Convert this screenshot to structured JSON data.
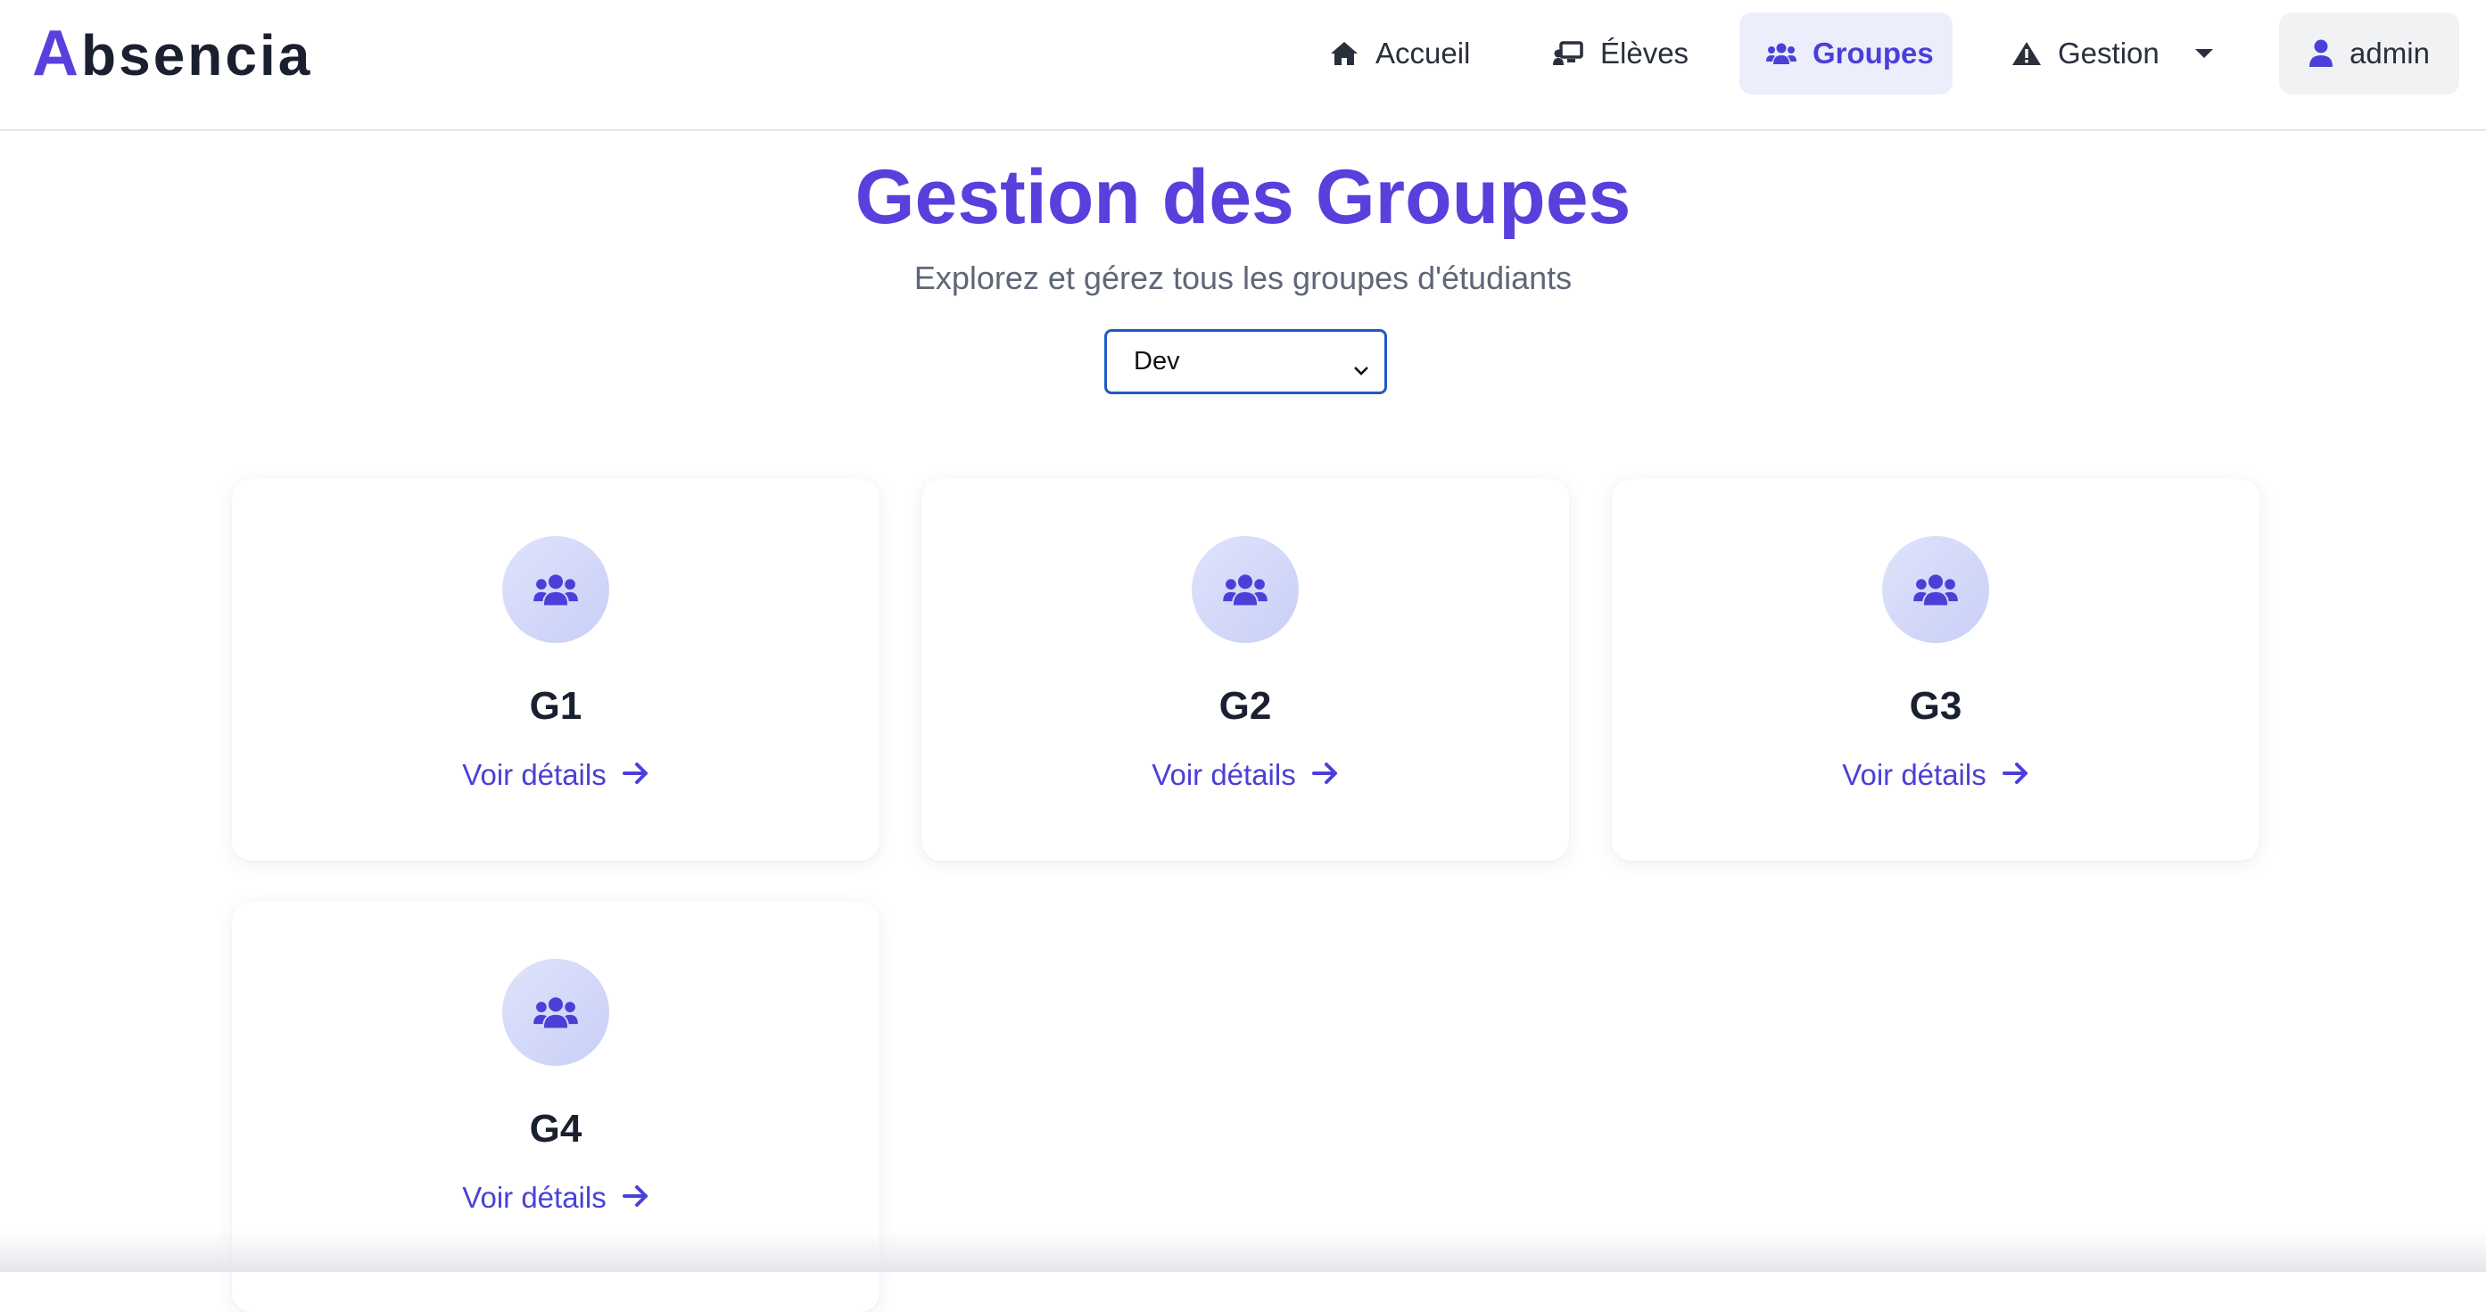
{
  "brand": {
    "first_letter": "A",
    "rest": "bsencia"
  },
  "nav": {
    "accueil": {
      "label": "Accueil",
      "icon": "home-icon"
    },
    "eleves": {
      "label": "Élèves",
      "icon": "chalkboard-user-icon"
    },
    "groupes": {
      "label": "Groupes",
      "icon": "users-icon",
      "active": true
    },
    "gestion": {
      "label": "Gestion",
      "icon": "warning-icon"
    },
    "admin": {
      "label": "admin",
      "icon": "user-icon"
    }
  },
  "header": {
    "title": "Gestion des Groupes",
    "subtitle": "Explorez et gérez tous les groupes d'étudiants"
  },
  "filter": {
    "selected": "Dev"
  },
  "groups": [
    {
      "name": "G1",
      "link_label": "Voir détails"
    },
    {
      "name": "G2",
      "link_label": "Voir détails"
    },
    {
      "name": "G3",
      "link_label": "Voir détails"
    },
    {
      "name": "G4",
      "link_label": "Voir détails"
    }
  ],
  "colors": {
    "brand": "#5b3fdc",
    "accent": "#4a40d8",
    "active_nav_bg": "#eceefc",
    "select_border": "#1f5ac4"
  }
}
